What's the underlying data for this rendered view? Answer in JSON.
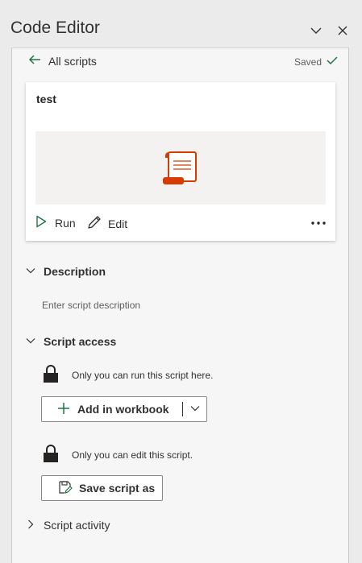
{
  "header": {
    "title": "Code Editor"
  },
  "nav": {
    "back_label": "All scripts",
    "status": "Saved"
  },
  "script": {
    "name": "test"
  },
  "actions": {
    "run_label": "Run",
    "edit_label": "Edit"
  },
  "description": {
    "heading": "Description",
    "placeholder": "Enter script description"
  },
  "access": {
    "heading": "Script access",
    "run_note": "Only you can run this script here.",
    "add_button": "Add in workbook",
    "edit_note": "Only you can edit this script.",
    "save_as_button": "Save script as"
  },
  "activity": {
    "heading": "Script activity"
  },
  "colors": {
    "accent_green": "#217346",
    "script_orange": "#d83b01"
  }
}
